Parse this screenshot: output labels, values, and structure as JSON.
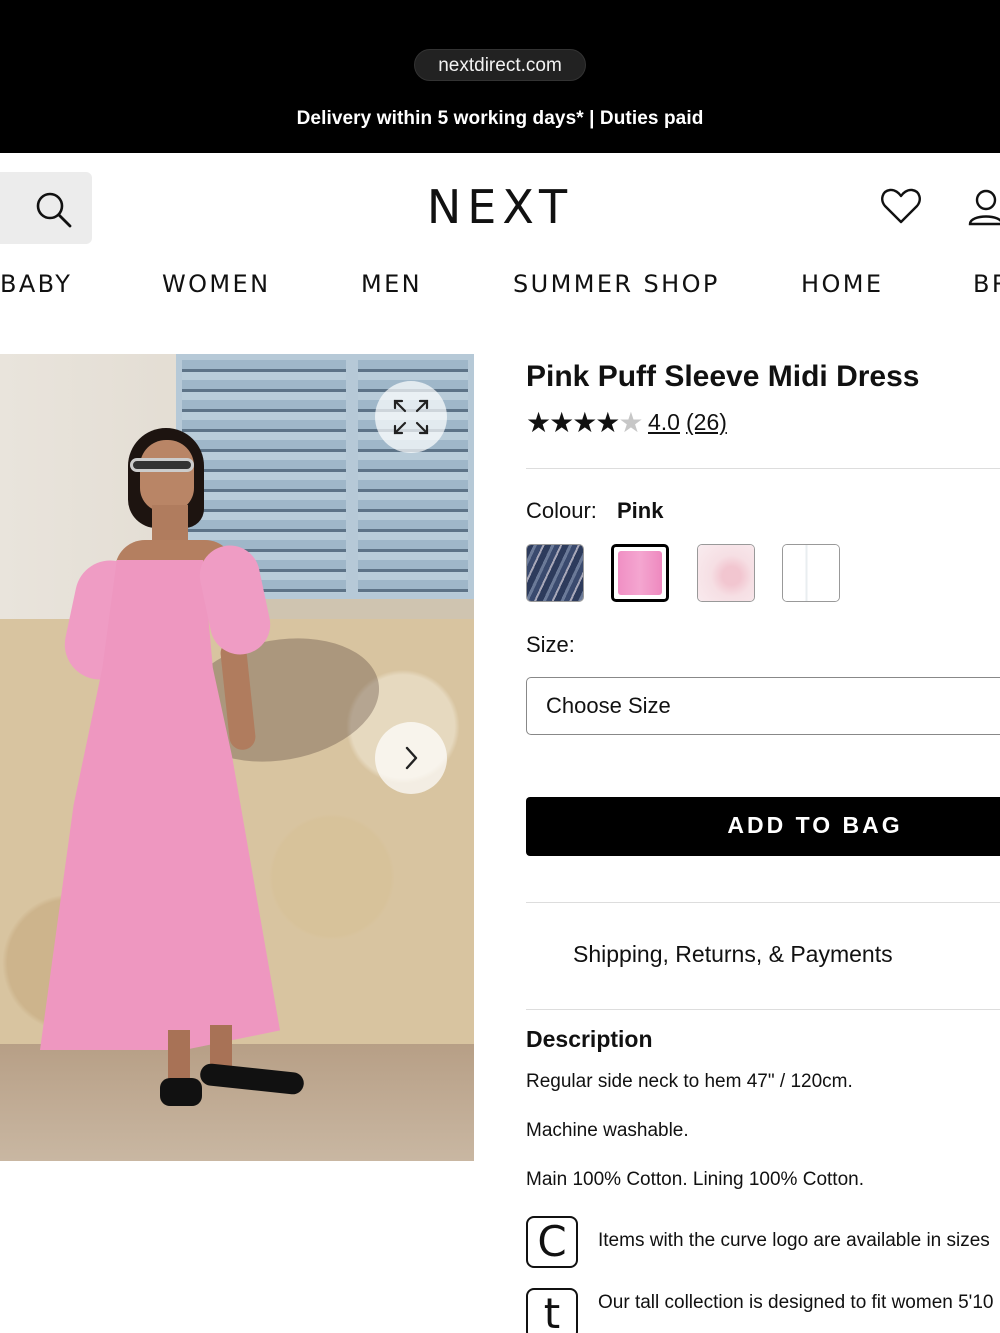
{
  "browser": {
    "url": "nextdirect.com"
  },
  "promo_banner": {
    "text": "Delivery within 5 working days* | Duties paid"
  },
  "header": {
    "logo": "NEXT",
    "icons": [
      "search-icon",
      "heart-icon",
      "account-icon"
    ]
  },
  "nav": {
    "items": [
      "BABY",
      "WOMEN",
      "MEN",
      "SUMMER SHOP",
      "HOME",
      "BR"
    ]
  },
  "product": {
    "title": "Pink Puff Sleeve Midi Dress",
    "rating": {
      "stars": 4,
      "max": 5,
      "value_text": "4.0",
      "count_text": "(26)"
    },
    "colour": {
      "label": "Colour:",
      "value": "Pink"
    },
    "swatches": [
      {
        "colour": "#3a4a6e",
        "selected": false
      },
      {
        "colour": "#f08fc4",
        "selected": true
      },
      {
        "colour": "#f4d6dd",
        "selected": false
      },
      {
        "colour": "#e8ebe6",
        "selected": false
      }
    ],
    "size": {
      "label": "Size:",
      "placeholder": "Choose Size"
    },
    "add_to_bag": "ADD TO BAG",
    "shipping": "Shipping, Returns, & Payments"
  },
  "description": {
    "title": "Description",
    "lines": [
      "Regular side neck to hem 47\" / 120cm.",
      "Machine washable.",
      "Main 100% Cotton. Lining 100% Cotton."
    ],
    "badges": [
      {
        "letter": "C",
        "text": "Items with the curve logo are available in sizes"
      },
      {
        "letter": "t",
        "text": "Our tall collection is designed to fit women 5'10"
      }
    ]
  },
  "colors": {
    "topbar": "#000000",
    "button": "#000000",
    "dress_pink": "#ee97c0"
  }
}
